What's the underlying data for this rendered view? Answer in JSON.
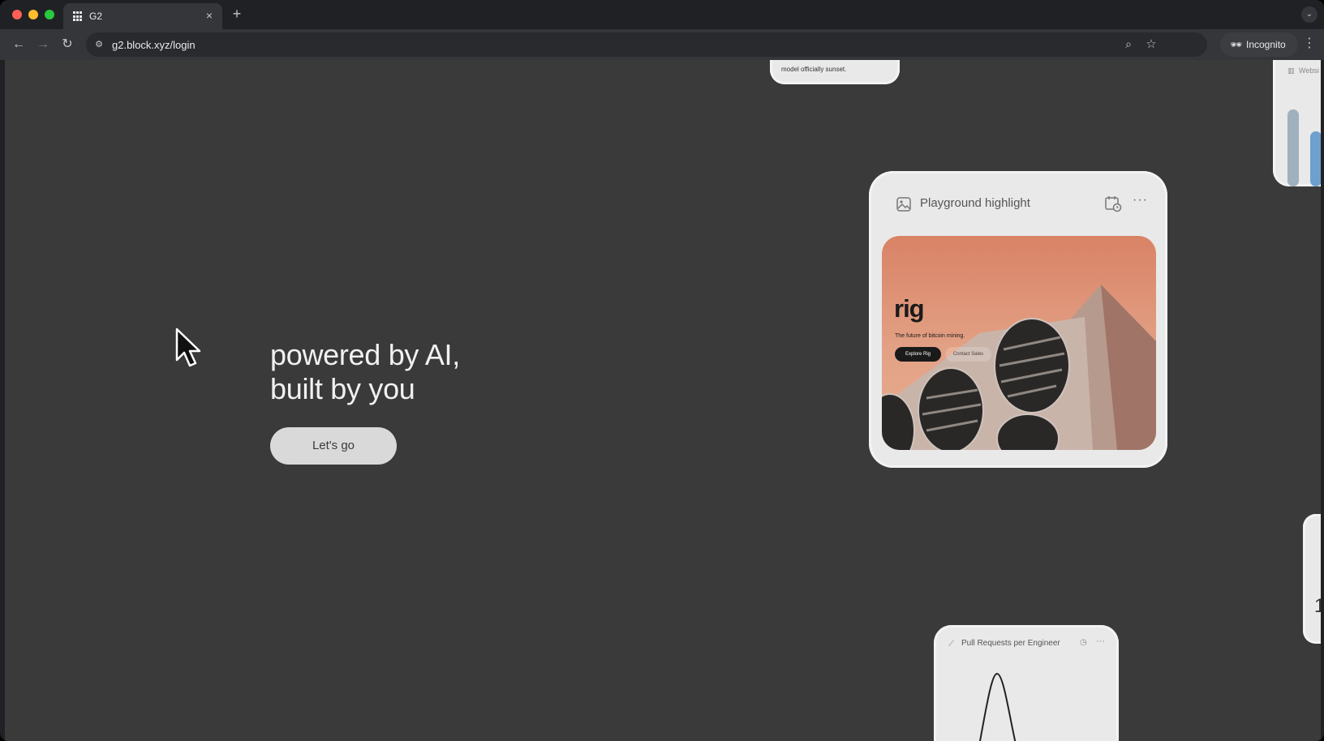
{
  "browser": {
    "tab": {
      "title": "G2",
      "close_glyph": "×"
    },
    "new_tab_glyph": "+",
    "tab_search_glyph": "⌄",
    "nav": {
      "back_glyph": "←",
      "forward_glyph": "→",
      "reload_glyph": "↻"
    },
    "url": "g2.block.xyz/login",
    "zoom_glyph": "⌕",
    "star_glyph": "☆",
    "incognito_label": "Incognito",
    "menu_glyph": "⋮"
  },
  "hero": {
    "line1": "powered by AI,",
    "line2": "built by you",
    "cta_label": "Let's go"
  },
  "cards": {
    "top_snippet": "model officially sunset.",
    "highlight": {
      "title": "Playground highlight",
      "more_glyph": "···",
      "preview": {
        "logo": "rig",
        "tagline": "The future of bitcoin mining.",
        "primary_button": "Explore Rig",
        "secondary_button": "Contact Sales"
      }
    },
    "right_top": {
      "label": "Websi"
    },
    "right_mid": {
      "value": "1"
    },
    "pull_requests": {
      "title": "Pull Requests per Engineer",
      "more_glyph": "···"
    }
  },
  "colors": {
    "viewport_bg": "#3a3a3a",
    "card_bg": "#e9e9e9",
    "cta_bg": "#d9d9d9",
    "preview_accent": "#d98266"
  },
  "icons": {
    "tab": "grid-favicon-icon",
    "highlight": "image-icon",
    "schedule": "calendar-clock-icon",
    "pr": "line-chart-icon",
    "cursor": "mouse-pointer-icon"
  }
}
